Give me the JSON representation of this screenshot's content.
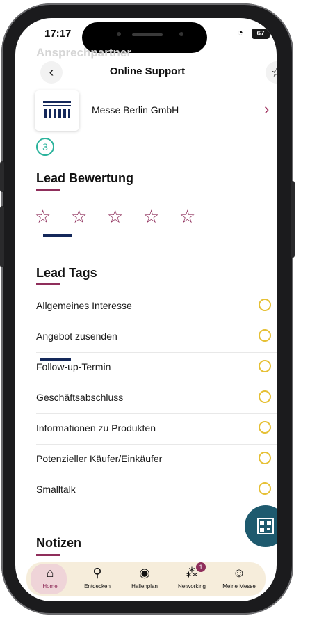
{
  "status_bar": {
    "time": "17:17",
    "battery": "67"
  },
  "header": {
    "faded_title": "Ansprechpartner",
    "title": "Online Support"
  },
  "company": {
    "name": "Messe Berlin GmbH"
  },
  "step": {
    "number": "3"
  },
  "rating": {
    "title": "Lead Bewertung",
    "stars_filled": 0,
    "stars_total": 5
  },
  "tags": {
    "title": "Lead Tags",
    "items": [
      {
        "label": "Allgemeines Interesse"
      },
      {
        "label": "Angebot zusenden"
      },
      {
        "label": "Follow-up-Termin"
      },
      {
        "label": "Geschäftsabschluss"
      },
      {
        "label": "Informationen zu Produkten"
      },
      {
        "label": "Potenzieller Käufer/Einkäufer"
      },
      {
        "label": "Smalltalk"
      }
    ]
  },
  "notes": {
    "title": "Notizen"
  },
  "bottom_nav": {
    "items": [
      {
        "label": "Home",
        "icon": "home-icon"
      },
      {
        "label": "Entdecken",
        "icon": "search-icon"
      },
      {
        "label": "Hallenplan",
        "icon": "location-pin-icon"
      },
      {
        "label": "Networking",
        "icon": "network-icon",
        "badge": "1"
      },
      {
        "label": "Meine Messe",
        "icon": "user-icon"
      }
    ]
  },
  "colors": {
    "accent": "#8f2e5b",
    "teal": "#2bb39c",
    "radio": "#e6c035",
    "fab": "#1e5a6e",
    "nav_bg": "#f6eddb"
  }
}
